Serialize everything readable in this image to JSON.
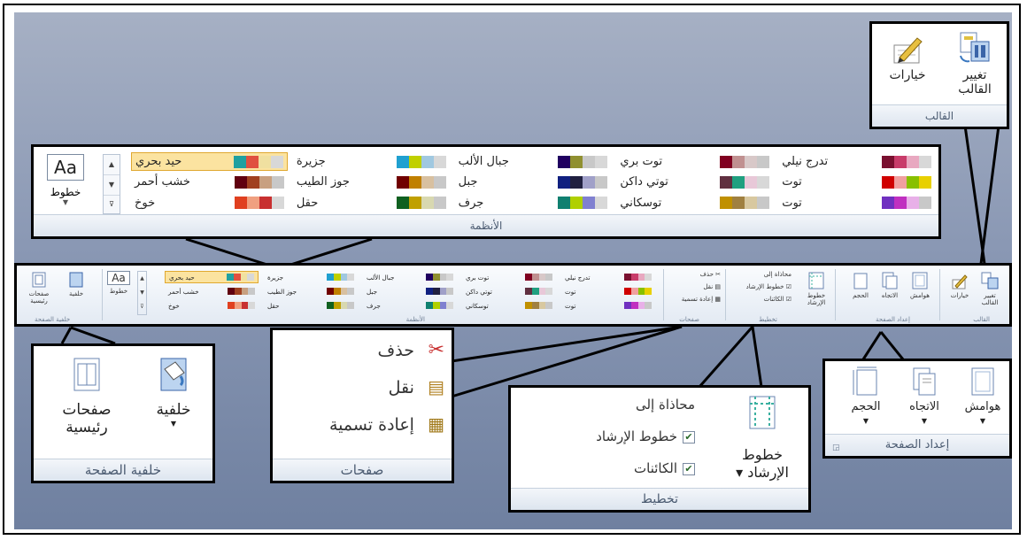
{
  "theme_group": {
    "change_theme_label_1": "تغيير",
    "change_theme_label_2": "القالب",
    "options_label": "خيارات",
    "group_label": "القالب"
  },
  "schemes_group": {
    "group_label": "الأنظمة",
    "fonts_button": "خطوط",
    "fonts_icon_text": "Aa",
    "schemes": [
      {
        "name": "تدرج نيلي",
        "colors": [
          "#7a1030",
          "#c83c6a",
          "#e8a8c0",
          "#d8d8d8"
        ]
      },
      {
        "name": "توت",
        "colors": [
          "#d00000",
          "#f0a0a0",
          "#88c000",
          "#e8d000"
        ]
      },
      {
        "name": "توت",
        "colors": [
          "#7030c0",
          "#c030c0",
          "#e8b0e8",
          "#c8c8c8"
        ]
      },
      {
        "name": "توت بري",
        "colors": [
          "#800020",
          "#c09090",
          "#d8c8c8",
          "#c8c8c8"
        ]
      },
      {
        "name": "توتي داكن",
        "colors": [
          "#603040",
          "#20a080",
          "#e8c8d8",
          "#d8d8d8"
        ]
      },
      {
        "name": "توسكاني",
        "colors": [
          "#c09000",
          "#a08040",
          "#d8c8a0",
          "#c8c8c8"
        ]
      },
      {
        "name": "جبال الألب",
        "colors": [
          "#200060",
          "#909030",
          "#c8c8c8",
          "#d8d8d8"
        ]
      },
      {
        "name": "جبل",
        "colors": [
          "#102080",
          "#202040",
          "#a0a0c8",
          "#c8c8c8"
        ]
      },
      {
        "name": "جرف",
        "colors": [
          "#108070",
          "#b0d000",
          "#8080d0",
          "#d8d8d8"
        ]
      },
      {
        "name": "جزيرة",
        "colors": [
          "#20a0d0",
          "#c0d000",
          "#a0c8e0",
          "#d8d8d8"
        ]
      },
      {
        "name": "جوز الطيب",
        "colors": [
          "#700000",
          "#c08000",
          "#d8c0a0",
          "#c8c8c8"
        ]
      },
      {
        "name": "حقل",
        "colors": [
          "#106020",
          "#c0a000",
          "#d8d8b0",
          "#c8c8c8"
        ]
      },
      {
        "name": "حيد بحري",
        "colors": [
          "#20a0a0",
          "#e05040",
          "#f0e0a0",
          "#d8d8d8"
        ]
      },
      {
        "name": "خشب أحمر",
        "colors": [
          "#600010",
          "#a04020",
          "#c8a080",
          "#c8c8c8"
        ]
      },
      {
        "name": "خوخ",
        "colors": [
          "#e04020",
          "#f0a080",
          "#c83030",
          "#d8d8d8"
        ]
      }
    ]
  },
  "pages_group": {
    "delete_label": "حذف",
    "move_label": "نقل",
    "rename_label": "إعادة تسمية",
    "group_label": "صفحات"
  },
  "layout_group": {
    "guides_button_1": "خطوط",
    "guides_button_2": "الإرشاد",
    "align_to": "محاذاة إلى",
    "guides_check": "خطوط الإرشاد",
    "objects_check": "الكائنات",
    "group_label": "تخطيط"
  },
  "page_setup_group": {
    "margins": "هوامش",
    "orientation": "الاتجاه",
    "size": "الحجم",
    "group_label": "إعداد الصفحة"
  },
  "page_background_group": {
    "background": "خلفية",
    "master_pages_1": "صفحات",
    "master_pages_2": "رئيسية",
    "group_label": "خلفية الصفحة"
  },
  "colors": {
    "highlight": "#fbe3a0",
    "highlight_border": "#e0a830"
  }
}
